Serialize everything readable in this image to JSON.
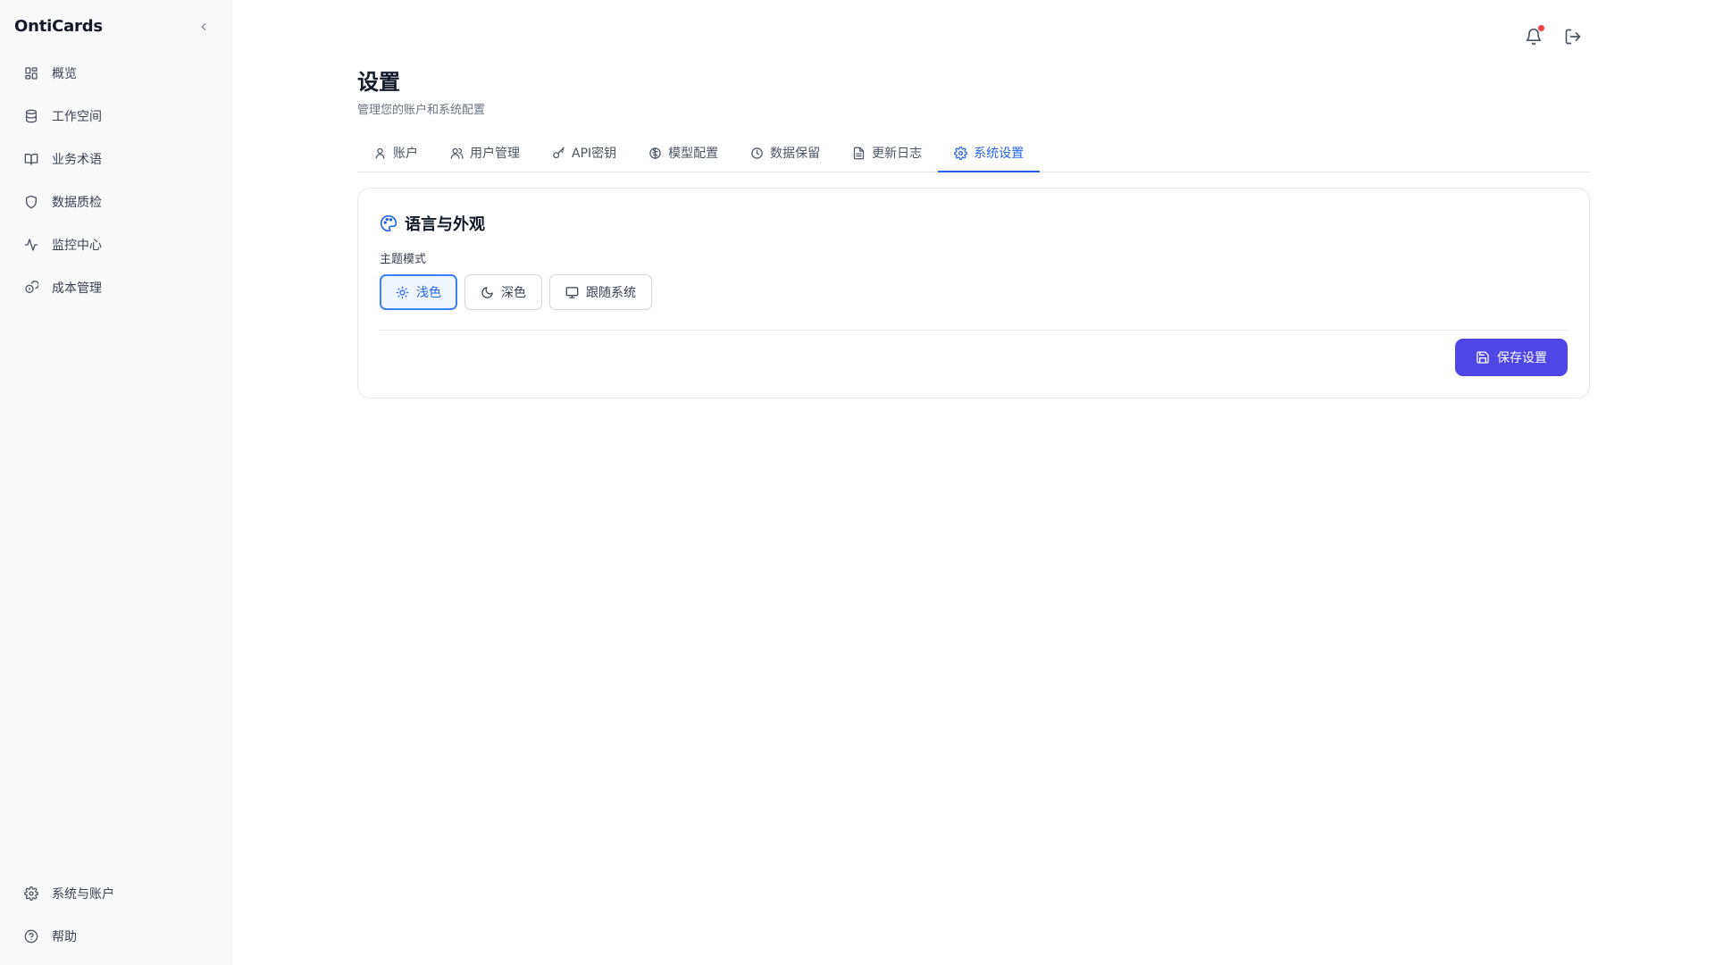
{
  "app": {
    "brand": "OntiCards"
  },
  "sidebar": {
    "items": [
      {
        "label": "概览",
        "icon": "layout-grid-icon"
      },
      {
        "label": "工作空间",
        "icon": "database-icon"
      },
      {
        "label": "业务术语",
        "icon": "book-open-icon"
      },
      {
        "label": "数据质检",
        "icon": "shield-icon"
      },
      {
        "label": "监控中心",
        "icon": "activity-icon"
      },
      {
        "label": "成本管理",
        "icon": "coins-icon"
      }
    ],
    "bottom_items": [
      {
        "label": "系统与账户",
        "icon": "gear-icon"
      },
      {
        "label": "帮助",
        "icon": "help-circle-icon"
      }
    ]
  },
  "header": {
    "notification_icon": "bell-icon",
    "logout_icon": "logout-icon",
    "has_unread": true
  },
  "page": {
    "title": "设置",
    "subtitle": "管理您的账户和系统配置"
  },
  "tabs": [
    {
      "label": "账户",
      "icon": "user-icon"
    },
    {
      "label": "用户管理",
      "icon": "users-icon"
    },
    {
      "label": "API密钥",
      "icon": "key-icon"
    },
    {
      "label": "模型配置",
      "icon": "brain-icon"
    },
    {
      "label": "数据保留",
      "icon": "clock-icon"
    },
    {
      "label": "更新日志",
      "icon": "file-text-icon"
    },
    {
      "label": "系统设置",
      "icon": "gear-icon",
      "active": true
    }
  ],
  "appearance": {
    "title": "语言与外观",
    "theme_label": "主题模式",
    "themes": [
      {
        "label": "浅色",
        "icon": "sun-icon",
        "selected": true
      },
      {
        "label": "深色",
        "icon": "moon-icon"
      },
      {
        "label": "跟随系统",
        "icon": "monitor-icon"
      }
    ],
    "save_label": "保存设置"
  },
  "colors": {
    "accent": "#2563eb",
    "primary_button": "#4f46e5",
    "notification_dot": "#ef4444"
  }
}
